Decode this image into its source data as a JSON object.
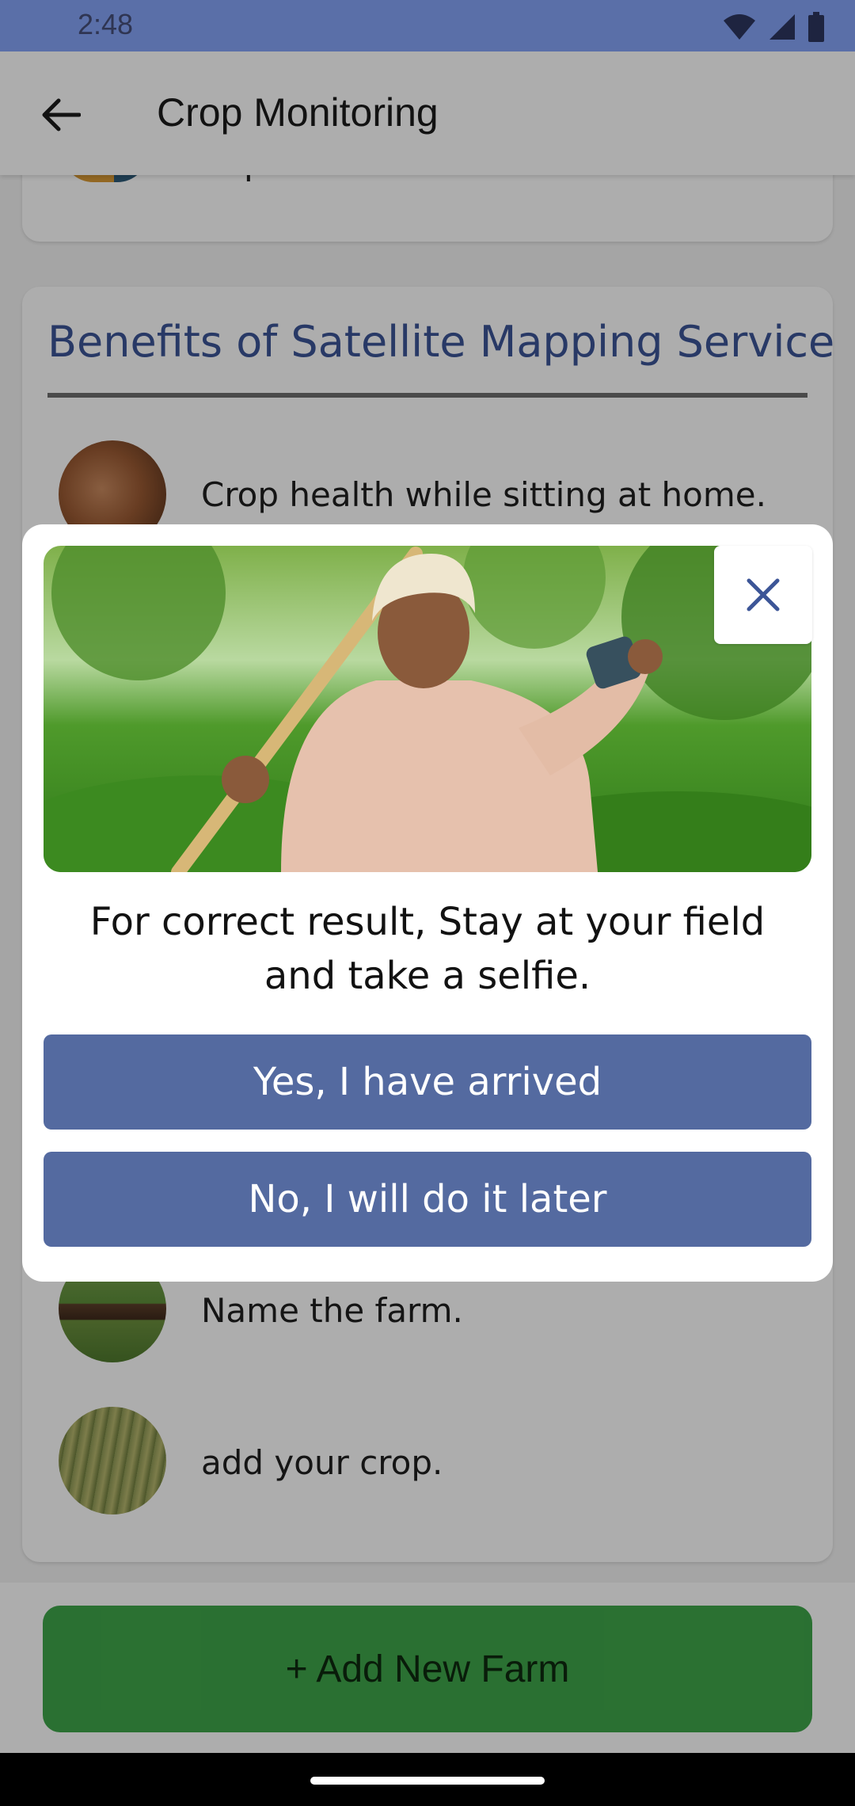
{
  "status_bar": {
    "time": "2:48",
    "icons": [
      "wifi-icon",
      "signal-icon",
      "battery-icon"
    ]
  },
  "app_bar": {
    "title": "Crop Monitoring",
    "back_icon": "arrow-left-icon"
  },
  "content": {
    "top_card_text": "Expert.",
    "benefits_heading": "Benefits of Satellite Mapping Service",
    "items": [
      {
        "text": "Crop health while sitting at home."
      },
      {
        "text": "Name the farm."
      },
      {
        "text": "add your crop."
      }
    ]
  },
  "bottom": {
    "add_farm_label": "+ Add New Farm"
  },
  "dialog": {
    "message": "For correct result, Stay at your field and take a selfie.",
    "yes_label": "Yes, I have arrived",
    "no_label": "No, I will do it later",
    "close_icon": "close-icon"
  },
  "colors": {
    "status_bar": "#5a6fa8",
    "heading": "#3c5597",
    "dialog_button": "#546aa0",
    "add_farm_button": "#3fa64a"
  }
}
